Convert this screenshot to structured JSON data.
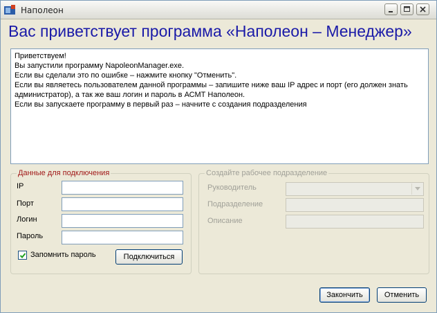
{
  "window": {
    "title": "Наполеон"
  },
  "header": {
    "welcome": "Вас приветствует программа «Наполеон – Менеджер»"
  },
  "message": {
    "lines": [
      "Приветствуем!",
      "Вы запустили программу NapoleonManager.exe.",
      "Если вы сделали это по ошибке – нажмите кнопку \"Отменить\".",
      "Если вы являетесь пользователем данной программы – запишите ниже ваш IP адрес и порт (его должен знать",
      "администратор), а так же ваш логин и пароль в АСМТ Наполеон.",
      "Если вы запускаете программу в первый раз – начните с создания подразделения"
    ]
  },
  "connection": {
    "title": "Данные для подключения",
    "ip_label": "IP",
    "ip_value": "",
    "port_label": "Порт",
    "port_value": "",
    "login_label": "Логин",
    "login_value": "",
    "password_label": "Пароль",
    "password_value": "",
    "remember_label": "Запомнить пароль",
    "remember_checked": true,
    "connect_button": "Подключиться"
  },
  "department": {
    "title": "Создайте рабочее подразделение",
    "head_label": "Руководитель",
    "head_value": "",
    "unit_label": "Подразделение",
    "unit_value": "",
    "description_label": "Описание",
    "description_value": ""
  },
  "footer": {
    "finish_button": "Закончить",
    "cancel_button": "Отменить"
  },
  "colors": {
    "welcome": "#1a1aa8",
    "connection_title": "#a01818",
    "disabled_text": "#a0a098"
  },
  "icons": {
    "app": "app-icon",
    "minimize": "minimize-icon",
    "maximize": "maximize-icon",
    "close": "close-icon",
    "combo": "chevron-down-icon",
    "check": "check-icon"
  }
}
